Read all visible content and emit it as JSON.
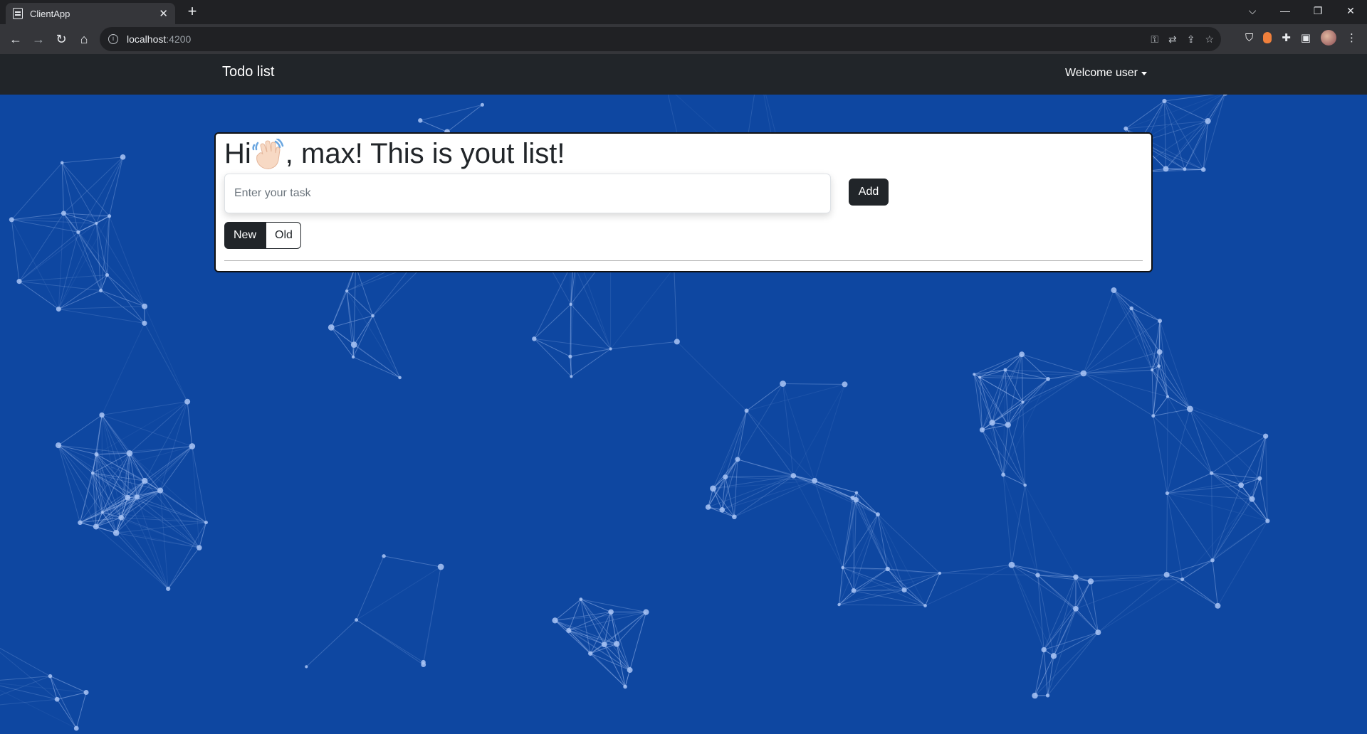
{
  "browser": {
    "tab_title": "ClientApp",
    "tab_close": "✕",
    "new_tab": "+",
    "url_host": "localhost",
    "url_port": ":4200",
    "window_controls": {
      "tabsearch": "⌵",
      "minimize": "—",
      "restore": "❐",
      "close": "✕"
    },
    "nav": {
      "back": "←",
      "forward": "→",
      "reload": "↻",
      "home": "⌂"
    }
  },
  "navbar": {
    "brand": "Todo list",
    "user_menu": "Welcome user"
  },
  "card": {
    "title_prefix": "Hi",
    "title_suffix": ", max! This is yout list!",
    "input_placeholder": "Enter your task",
    "input_value": "",
    "add_label": "Add",
    "toggle": {
      "new_label": "New",
      "old_label": "Old",
      "selected": "New"
    }
  },
  "colors": {
    "background": "#0e47a1",
    "navbar": "#212529",
    "button_dark": "#212529",
    "network_lines": "#a9c4f5"
  },
  "icons": {
    "waving_hand": "waving-hand-icon",
    "tab_favicon": "document-icon",
    "info": "info-icon"
  }
}
